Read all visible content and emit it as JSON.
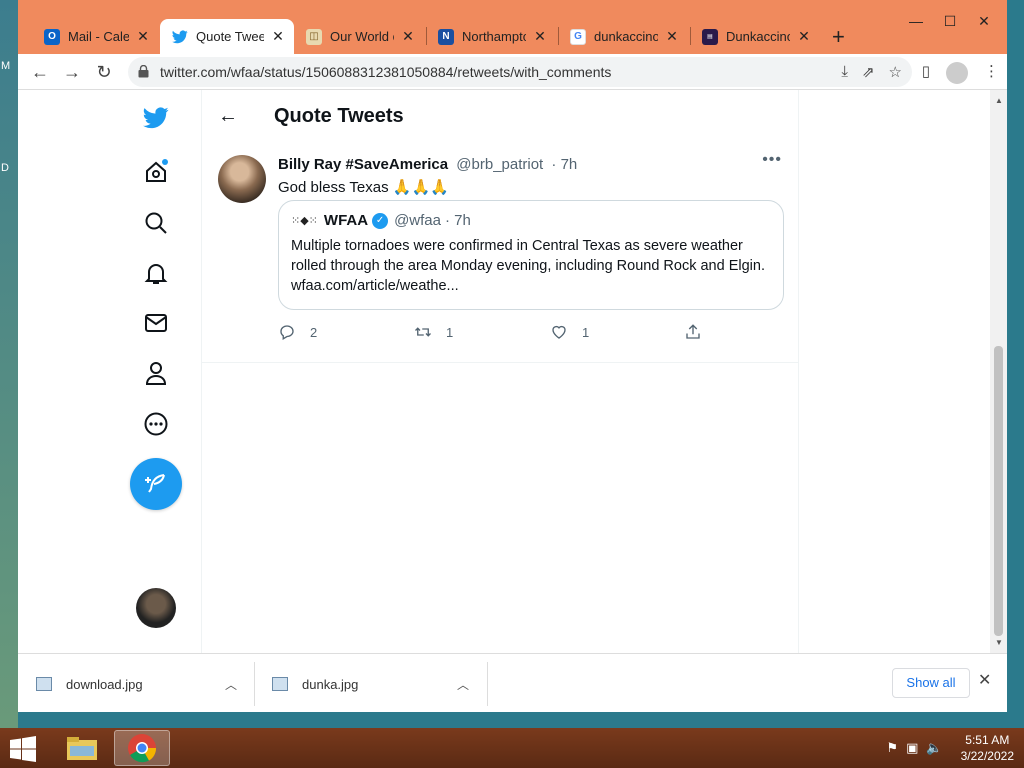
{
  "desktop": {
    "edge_text_top": "M",
    "edge_text_mid": "D"
  },
  "tabs": [
    {
      "label": "Mail - Caleb",
      "icon": "outlook-icon",
      "active": false
    },
    {
      "label": "Quote Tweet",
      "icon": "twitter-icon",
      "active": true
    },
    {
      "label": "Our World c",
      "icon": "owid-icon",
      "active": false
    },
    {
      "label": "Northampto",
      "icon": "n-icon",
      "active": false
    },
    {
      "label": "dunkaccino",
      "icon": "google-icon",
      "active": false
    },
    {
      "label": "Dunkaccino",
      "icon": "dunkin-icon",
      "active": false
    }
  ],
  "toolbar": {
    "url": "twitter.com/wfaa/status/1506088312381050884/retweets/with_comments"
  },
  "page": {
    "title": "Quote Tweets"
  },
  "tweet": {
    "name": "Billy Ray #SaveAmerica",
    "handle": "@brb_patriot",
    "time": "· 7h",
    "text": "God bless Texas 🙏🙏🙏",
    "quote": {
      "logo": "⁙◆⁙",
      "name": "WFAA",
      "handle": "@wfaa",
      "time": "· 7h",
      "text": "Multiple tornadoes were confirmed in Central Texas as severe weather rolled through the area Monday evening, including Round Rock and Elgin. wfaa.com/article/weathe..."
    },
    "replies": "2",
    "retweets": "1",
    "likes": "1"
  },
  "downloads": {
    "items": [
      "download.jpg",
      "dunka.jpg"
    ],
    "show_all": "Show all"
  },
  "taskbar": {
    "time": "5:51 AM",
    "date": "3/22/2022"
  },
  "colors": {
    "twitter_blue": "#1d9bf0",
    "window_frame": "#f08a5d"
  }
}
